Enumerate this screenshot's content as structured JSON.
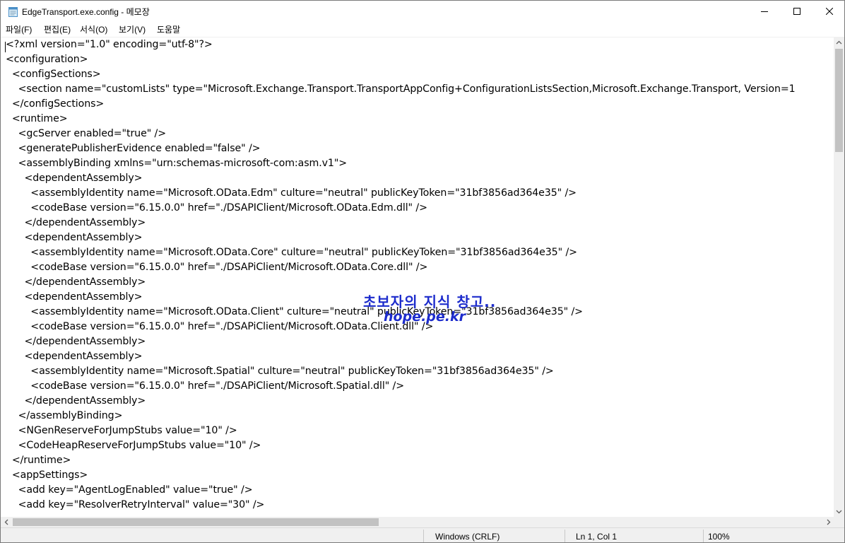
{
  "window": {
    "title": "EdgeTransport.exe.config - 메모장"
  },
  "menu": {
    "items": [
      "파일(F)",
      "편집(E)",
      "서식(O)",
      "보기(V)",
      "도움말"
    ]
  },
  "editor": {
    "lines": [
      "<?xml version=\"1.0\" encoding=\"utf-8\"?>",
      "<configuration>",
      "  <configSections>",
      "    <section name=\"customLists\" type=\"Microsoft.Exchange.Transport.TransportAppConfig+ConfigurationListsSection,Microsoft.Exchange.Transport, Version=1",
      "  </configSections>",
      "  <runtime>",
      "    <gcServer enabled=\"true\" />",
      "    <generatePublisherEvidence enabled=\"false\" />",
      "    <assemblyBinding xmlns=\"urn:schemas-microsoft-com:asm.v1\">",
      "      <dependentAssembly>",
      "        <assemblyIdentity name=\"Microsoft.OData.Edm\" culture=\"neutral\" publicKeyToken=\"31bf3856ad364e35\" />",
      "        <codeBase version=\"6.15.0.0\" href=\"./DSAPIClient/Microsoft.OData.Edm.dll\" />",
      "      </dependentAssembly>",
      "      <dependentAssembly>",
      "        <assemblyIdentity name=\"Microsoft.OData.Core\" culture=\"neutral\" publicKeyToken=\"31bf3856ad364e35\" />",
      "        <codeBase version=\"6.15.0.0\" href=\"./DSAPiClient/Microsoft.OData.Core.dll\" />",
      "      </dependentAssembly>",
      "      <dependentAssembly>",
      "        <assemblyIdentity name=\"Microsoft.OData.Client\" culture=\"neutral\" publicKeyToken=\"31bf3856ad364e35\" />",
      "        <codeBase version=\"6.15.0.0\" href=\"./DSAPiClient/Microsoft.OData.Client.dll\" />",
      "      </dependentAssembly>",
      "      <dependentAssembly>",
      "        <assemblyIdentity name=\"Microsoft.Spatial\" culture=\"neutral\" publicKeyToken=\"31bf3856ad364e35\" />",
      "        <codeBase version=\"6.15.0.0\" href=\"./DSAPiClient/Microsoft.Spatial.dll\" />",
      "      </dependentAssembly>",
      "    </assemblyBinding>",
      "    <NGenReserveForJumpStubs value=\"10\" />",
      "    <CodeHeapReserveForJumpStubs value=\"10\" />",
      "  </runtime>",
      "  <appSettings>",
      "    <add key=\"AgentLogEnabled\" value=\"true\" />",
      "    <add key=\"ResolverRetryInterval\" value=\"30\" />"
    ]
  },
  "watermark": {
    "line1": "초보자의 지식 창고..",
    "line2": "hope.pe.kr"
  },
  "status": {
    "line_ending": "Windows (CRLF)",
    "position": "Ln 1, Col 1",
    "zoom": "100%"
  },
  "icons": {
    "app": "notepad-icon",
    "minimize": "minimize-icon",
    "maximize": "maximize-icon",
    "close": "close-icon"
  }
}
